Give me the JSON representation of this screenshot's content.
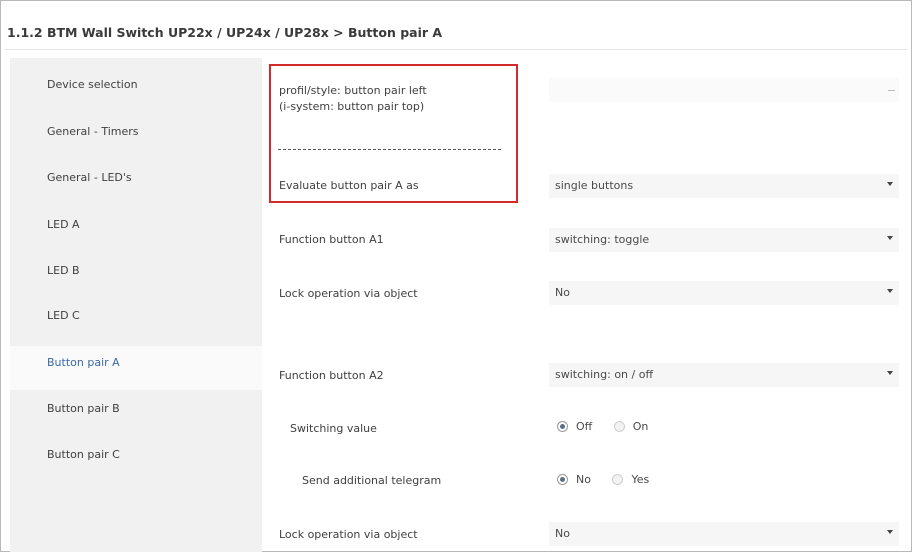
{
  "header": {
    "title": "1.1.2 BTM Wall Switch UP22x / UP24x / UP28x > Button pair A"
  },
  "sidebar": {
    "items": [
      {
        "label": "Device selection"
      },
      {
        "label": "General - Timers"
      },
      {
        "label": "General - LED's"
      },
      {
        "label": "LED A"
      },
      {
        "label": "LED B"
      },
      {
        "label": "LED C"
      },
      {
        "label": "Button pair A",
        "active": true
      },
      {
        "label": "Button pair B"
      },
      {
        "label": "Button pair C"
      }
    ]
  },
  "params": {
    "profile_label_line1": "profil/style: button pair left",
    "profile_label_line2": "(i-system: button pair top)",
    "profile_value": "",
    "evaluate_label": "Evaluate button pair A as",
    "evaluate_value": "single buttons",
    "func_a1_label": "Function button A1",
    "func_a1_value": "switching: toggle",
    "lock1_label": "Lock operation via object",
    "lock1_value": "No",
    "func_a2_label": "Function button A2",
    "func_a2_value": "switching: on / off",
    "switching_value_label": "Switching value",
    "switching_opt_off": "Off",
    "switching_opt_on": "On",
    "send_telegram_label": "Send additional telegram",
    "send_opt_no": "No",
    "send_opt_yes": "Yes",
    "lock2_label": "Lock operation via object",
    "lock2_value": "No"
  },
  "colors": {
    "highlight": "#d32a2a",
    "active_nav": "#3b6aa6",
    "sidebar_bg": "#f1f1f1"
  }
}
